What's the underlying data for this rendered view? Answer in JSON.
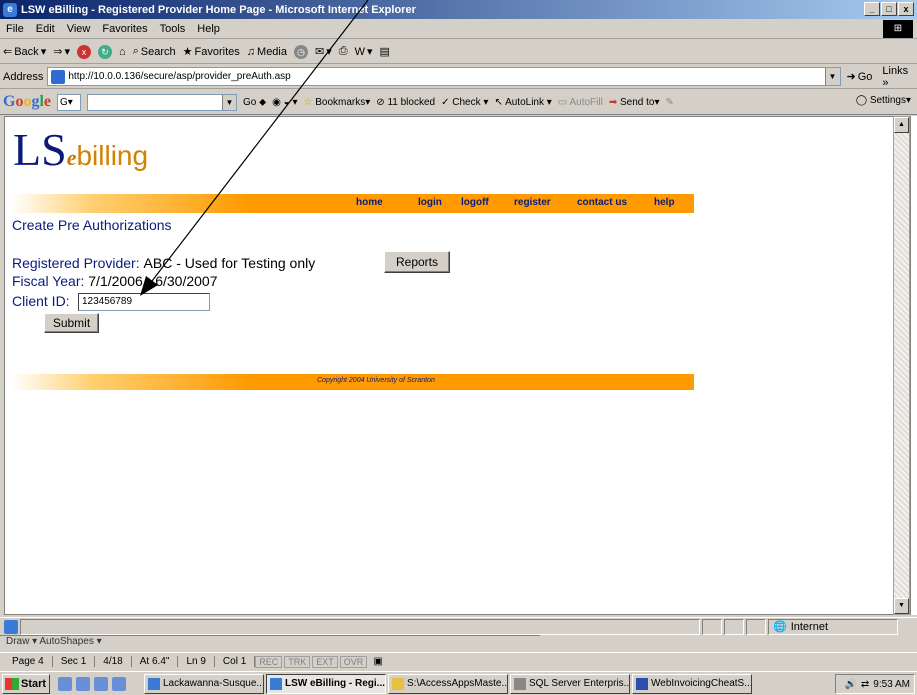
{
  "window": {
    "title": "LSW eBilling - Registered Provider Home Page - Microsoft Internet Explorer",
    "minimize": "_",
    "maximize": "□",
    "close": "x"
  },
  "menu": [
    "File",
    "Edit",
    "View",
    "Favorites",
    "Tools",
    "Help"
  ],
  "toolbar": {
    "back": "Back",
    "search": "Search",
    "favorites": "Favorites",
    "media": "Media"
  },
  "address": {
    "label": "Address",
    "url": "http://10.0.0.136/secure/asp/provider_preAuth.asp",
    "go": "Go",
    "links": "Links"
  },
  "googlebar": {
    "logo": [
      "G",
      "o",
      "o",
      "g",
      "l",
      "e"
    ],
    "g_button": "G",
    "go": "Go",
    "bookmarks": "Bookmarks",
    "blocked": "11 blocked",
    "check": "Check",
    "autolink": "AutoLink",
    "autofill": "AutoFill",
    "send_to": "Send to",
    "settings": "Settings"
  },
  "page": {
    "logo_ls": "LS",
    "logo_e": "e",
    "logo_billing": "billing",
    "nav": [
      "home",
      "login",
      "logoff",
      "register",
      "contact us",
      "help"
    ],
    "title": "Create Pre Authorizations",
    "provider_label": "Registered Provider:",
    "provider_value": "ABC - Used for Testing only",
    "fiscal_label": "Fiscal Year:",
    "fiscal_value": "7/1/2006 - 6/30/2007",
    "client_label": "Client ID:",
    "client_value": "123456789",
    "reports_button": "Reports",
    "submit_button": "Submit",
    "copyright": "Copyright 2004   University of Scranton"
  },
  "status": {
    "zone": "Internet"
  },
  "word_status": {
    "drawbar": "Draw ▾   AutoShapes ▾",
    "page": "Page 4",
    "sec": "Sec 1",
    "pages": "4/18",
    "at": "At 6.4\"",
    "ln": "Ln 9",
    "col": "Col 1",
    "rec": "REC",
    "trk": "TRK",
    "ext": "EXT",
    "ovr": "OVR"
  },
  "taskbar": {
    "start": "Start",
    "tasks": [
      "Lackawanna-Susque...",
      "LSW eBilling - Regi...",
      "S:\\AccessAppsMaste...",
      "SQL Server Enterpris...",
      "WebInvoicingCheatS..."
    ],
    "active_index": 1,
    "clock": "9:53 AM"
  }
}
